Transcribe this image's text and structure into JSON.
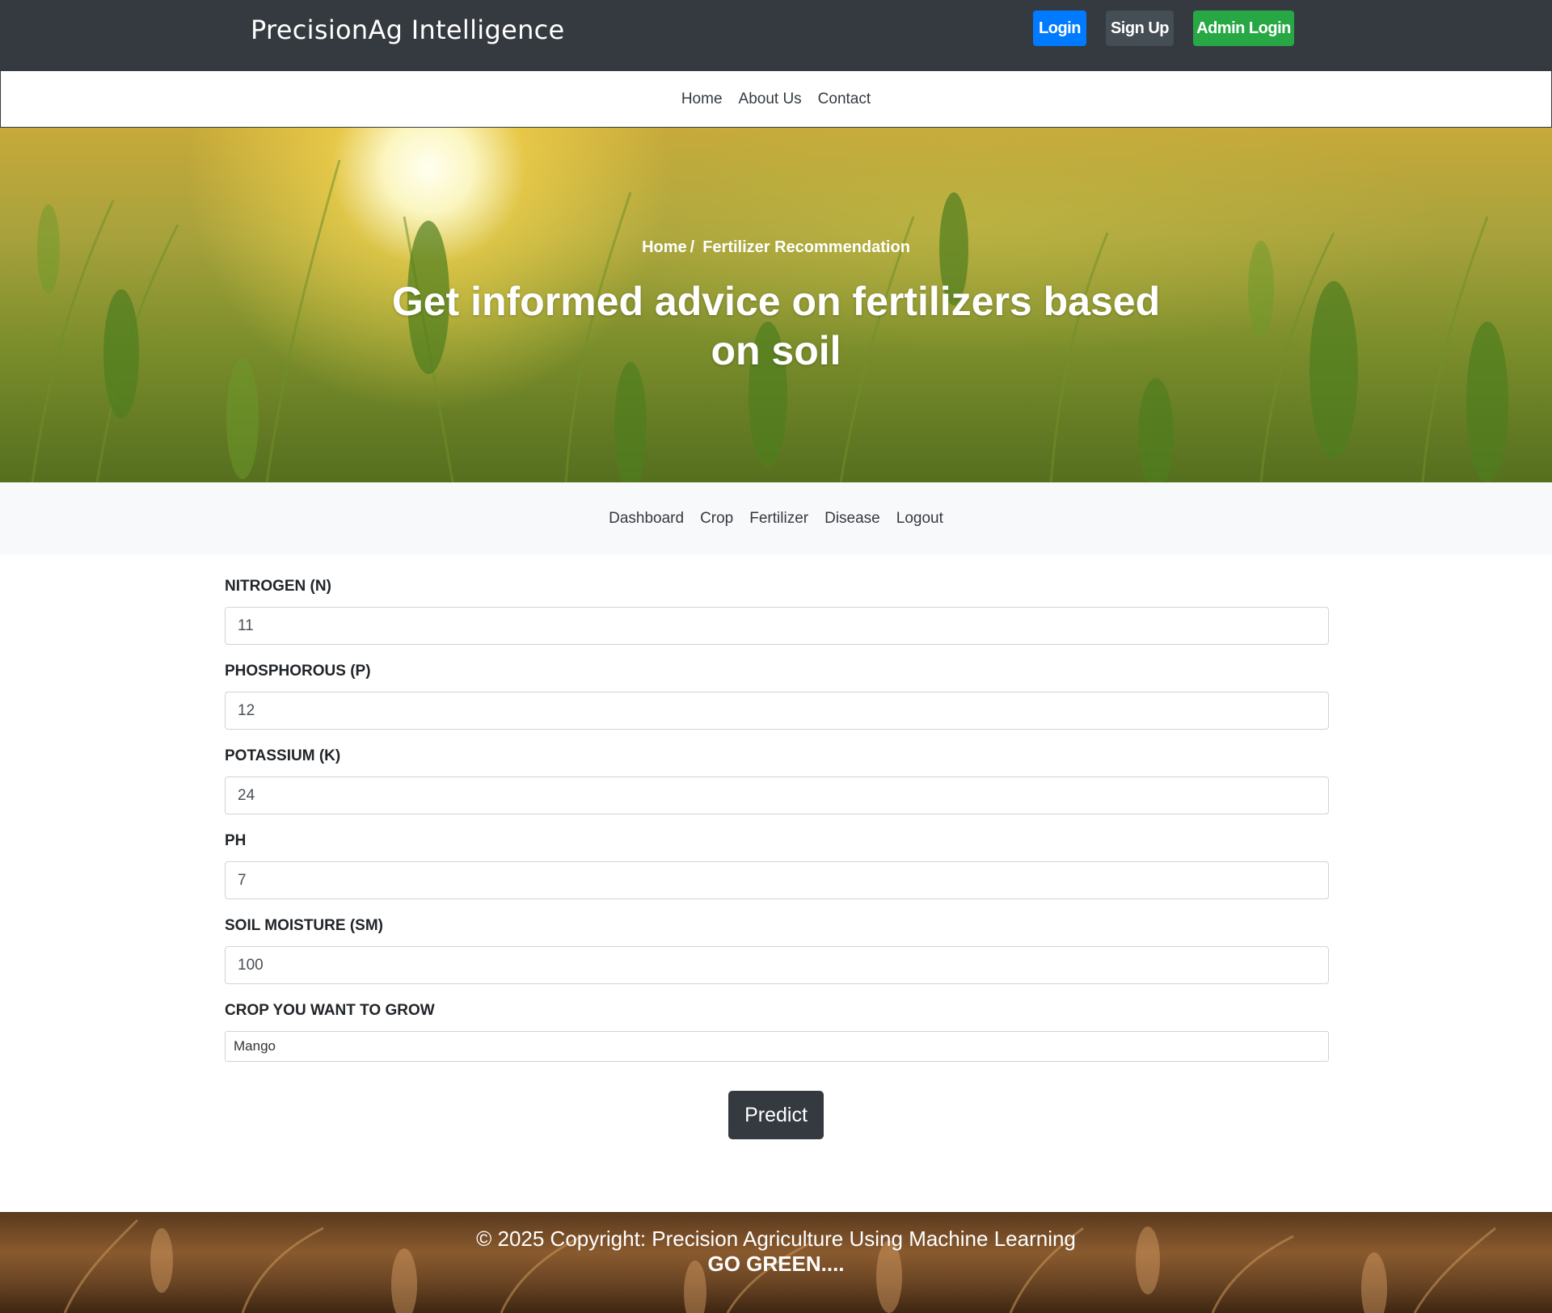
{
  "header": {
    "brand": "PrecisionAg Intelligence",
    "buttons": {
      "login": "Login",
      "signup": "Sign Up",
      "admin": "Admin Login"
    }
  },
  "nav": {
    "items": [
      "Home",
      "About Us",
      "Contact"
    ]
  },
  "hero": {
    "breadcrumb_home": "Home",
    "breadcrumb_sep": "/",
    "breadcrumb_current": "Fertilizer Recommendation",
    "title": "Get informed advice on fertilizers based on soil"
  },
  "subnav": {
    "items": [
      "Dashboard",
      "Crop",
      "Fertilizer",
      "Disease",
      "Logout"
    ]
  },
  "form": {
    "fields": [
      {
        "label": "NITROGEN (N)",
        "value": "11"
      },
      {
        "label": "PHOSPHOROUS (P)",
        "value": "12"
      },
      {
        "label": "POTASSIUM (K)",
        "value": "24"
      },
      {
        "label": "PH",
        "value": "7"
      },
      {
        "label": "SOIL MOISTURE (SM)",
        "value": "100"
      }
    ],
    "crop_label": "CROP YOU WANT TO GROW",
    "crop_value": "Mango",
    "submit": "Predict"
  },
  "footer": {
    "copyright": "© 2025 Copyright: Precision Agriculture Using Machine Learning",
    "tagline": "GO GREEN...."
  },
  "colors": {
    "header_bg": "#343a40",
    "login": "#007bff",
    "signup": "#454d55",
    "admin": "#28a745"
  }
}
